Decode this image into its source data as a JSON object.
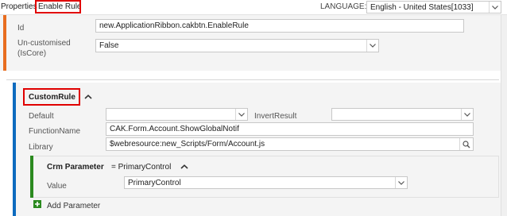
{
  "header": {
    "properties_label": "Properties",
    "title": "Enable Rule",
    "language_label": "LANGUAGE:",
    "language_value": "English - United States[1033]"
  },
  "form": {
    "id_label": "Id",
    "id_value": "new.ApplicationRibbon.cakbtn.EnableRule",
    "uncustomised_label_line1": "Un-customised",
    "uncustomised_label_line2": "(IsCore)",
    "uncustomised_value": "False"
  },
  "custom_rule": {
    "title": "CustomRule",
    "default_label": "Default",
    "default_value": "",
    "invert_label": "InvertResult",
    "invert_value": "",
    "function_label": "FunctionName",
    "function_value": "CAK.Form.Account.ShowGlobalNotif",
    "library_label": "Library",
    "library_value": "$webresource:new_Scripts/Form/Account.js"
  },
  "crm_parameter": {
    "title": "Crm Parameter",
    "subtitle": "= PrimaryControl",
    "value_label": "Value",
    "value": "PrimaryControl"
  },
  "add_parameter": {
    "label": "Add Parameter"
  },
  "colors": {
    "accent_blue": "#0d6bbf",
    "accent_orange": "#e86d1f",
    "accent_green": "#2b8a1f",
    "highlight_red": "#e00000"
  }
}
